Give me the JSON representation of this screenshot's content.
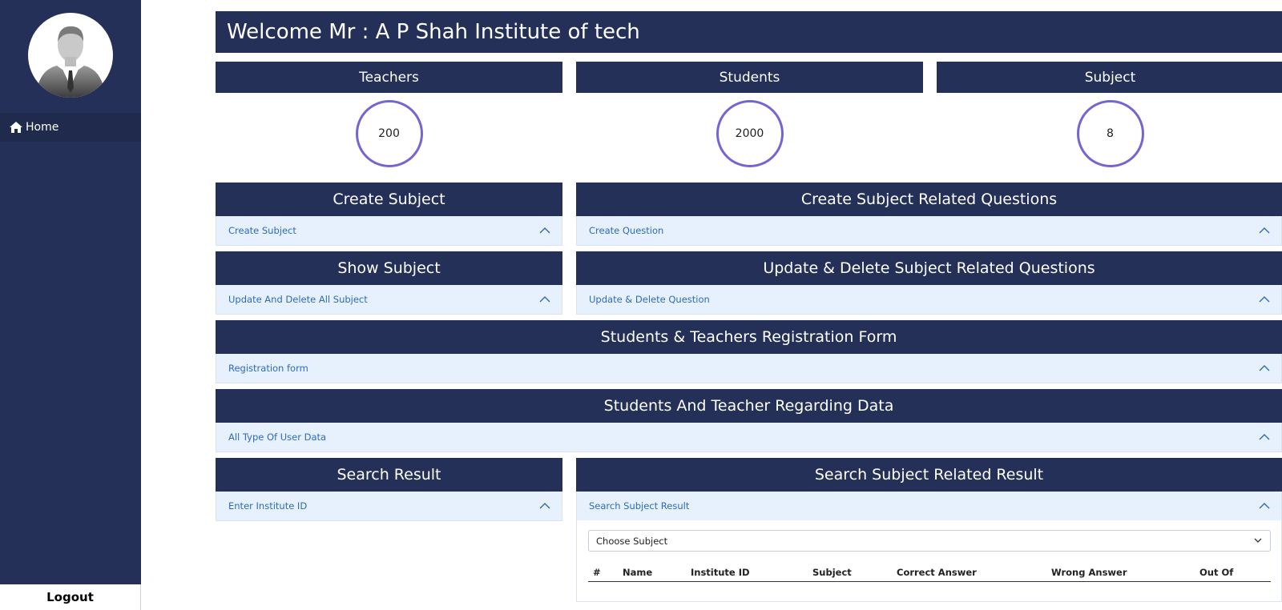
{
  "sidebar": {
    "home_label": "Home",
    "logout_label": "Logout"
  },
  "header": {
    "welcome": "Welcome Mr : A P Shah Institute of tech"
  },
  "stats": [
    {
      "label": "Teachers",
      "value": "200"
    },
    {
      "label": "Students",
      "value": "2000"
    },
    {
      "label": "Subject",
      "value": "8"
    }
  ],
  "cards": {
    "create_subject": {
      "title": "Create Subject",
      "item": "Create Subject"
    },
    "create_questions": {
      "title": "Create Subject Related Questions",
      "item": "Create Question"
    },
    "show_subject": {
      "title": "Show Subject",
      "item": "Update And Delete All Subject"
    },
    "update_questions": {
      "title": "Update & Delete Subject Related Questions",
      "item": "Update & Delete Question"
    },
    "registration": {
      "title": "Students & Teachers Registration Form",
      "item": "Registration form"
    },
    "user_data": {
      "title": "Students And Teacher Regarding Data",
      "item": "All Type Of User Data"
    },
    "search_result": {
      "title": "Search Result",
      "item": "Enter Institute ID"
    },
    "subject_result": {
      "title": "Search Subject Related Result",
      "item": "Search Subject Result"
    }
  },
  "result_table": {
    "select_value": "Choose Subject",
    "columns": [
      "#",
      "Name",
      "Institute ID",
      "Subject",
      "Correct Answer",
      "Wrong Answer",
      "Out Of"
    ]
  },
  "colors": {
    "navy": "#243058",
    "accordion_bg": "#e7f1fd",
    "link_blue": "#2d6bb7",
    "circle": "#7466cf"
  },
  "icons": {
    "home": "home-icon",
    "avatar": "user-avatar-icon",
    "chevron": "chevron-up-icon",
    "select": "chevron-down-icon"
  }
}
